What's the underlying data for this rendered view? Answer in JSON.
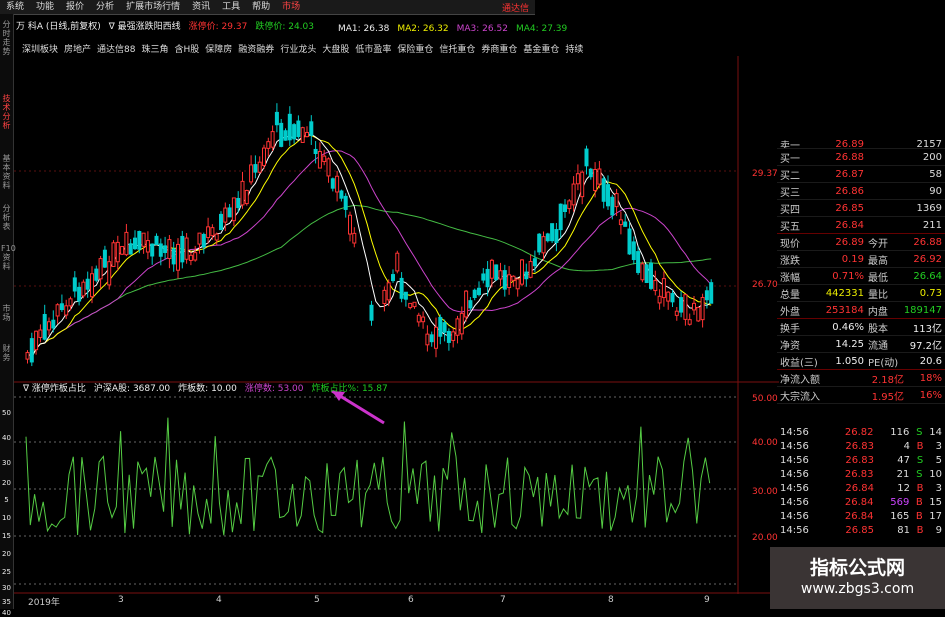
{
  "menu": {
    "items": [
      "系统",
      "功能",
      "报价",
      "分析",
      "扩展市场行情",
      "资讯",
      "工具",
      "帮助"
    ],
    "active": "市场",
    "brand": "通达信"
  },
  "header": {
    "title": "万 科A (日线,前复权)",
    "formula": "∇ 最强涨跌阳西线",
    "up_price_label": "涨停价: 29.37",
    "down_price_label": "跌停价: 24.03",
    "ma": [
      "MA1: 26.38",
      "MA2: 26.32",
      "MA3: 26.52",
      "MA4: 27.39"
    ]
  },
  "sectors": [
    "深圳板块",
    "房地产",
    "通达信88",
    "珠三角",
    "含H股",
    "保障房",
    "融资融券",
    "行业龙头",
    "大盘股",
    "低市盈率",
    "保险重仓",
    "信托重仓",
    "券商重仓",
    "基金重仓",
    "持续"
  ],
  "side_tabs": [
    "分时走势",
    "技术分析",
    "基本资料",
    "分析表",
    "F10资料",
    "市场",
    "财务"
  ],
  "left_ticks": [
    "50",
    "40",
    "30",
    "20",
    "5",
    "10",
    "15",
    "20",
    "25",
    "30",
    "35",
    "40",
    "0"
  ],
  "price_axis": {
    "top": "29.37",
    "mid": "26.70"
  },
  "indicator": {
    "name": "∇ 涨停炸板占比",
    "market": "沪深A股: 3687.00",
    "zhaban": "炸板数: 10.00",
    "zhangting": "涨停数: 53.00",
    "ratio": "炸板占比%: 15.87",
    "axis": [
      "50.00",
      "40.00",
      "30.00",
      "20.00"
    ]
  },
  "order_book": [
    [
      "卖一",
      "26.89",
      "2157"
    ],
    [
      "买一",
      "26.88",
      "200"
    ],
    [
      "买二",
      "26.87",
      "58"
    ],
    [
      "买三",
      "26.86",
      "90"
    ],
    [
      "买四",
      "26.85",
      "1369"
    ],
    [
      "买五",
      "26.84",
      "211"
    ]
  ],
  "quote": [
    [
      "现价",
      "26.89",
      "今开",
      "26.88"
    ],
    [
      "涨跌",
      "0.19",
      "最高",
      "26.92"
    ],
    [
      "涨幅",
      "0.71%",
      "最低",
      "26.64"
    ],
    [
      "总量",
      "442331",
      "量比",
      "0.73"
    ],
    [
      "外盘",
      "253184",
      "内盘",
      "189147"
    ],
    [
      "换手",
      "0.46%",
      "股本",
      "113亿"
    ],
    [
      "净资",
      "14.25",
      "流通",
      "97.2亿"
    ],
    [
      "收益(三)",
      "1.050",
      "PE(动)",
      "20.6"
    ]
  ],
  "flow": [
    [
      "净流入额",
      "2.18亿",
      "18%"
    ],
    [
      "大宗流入",
      "1.95亿",
      "16%"
    ]
  ],
  "ticks": [
    [
      "14:56",
      "26.82",
      "116",
      "S",
      "14"
    ],
    [
      "14:56",
      "26.83",
      "4",
      "B",
      "3"
    ],
    [
      "14:56",
      "26.83",
      "47",
      "S",
      "5"
    ],
    [
      "14:56",
      "26.83",
      "21",
      "S",
      "10"
    ],
    [
      "14:56",
      "26.84",
      "12",
      "B",
      "3"
    ],
    [
      "14:56",
      "26.84",
      "569",
      "B",
      "15"
    ],
    [
      "14:56",
      "26.84",
      "165",
      "B",
      "17"
    ],
    [
      "14:56",
      "26.85",
      "81",
      "B",
      "9"
    ]
  ],
  "xaxis": [
    "2019年",
    "3",
    "4",
    "5",
    "6",
    "7",
    "8",
    "9"
  ],
  "watermark": {
    "line1": "指标公式网",
    "line2": "www.zbgs3.com"
  },
  "colors": {
    "up": "#ff3333",
    "down": "#00cccc",
    "ma1": "#ffffff",
    "ma2": "#ffff00",
    "ma3": "#cc44cc",
    "ma4": "#44bb44",
    "ind": "#55cc44"
  }
}
